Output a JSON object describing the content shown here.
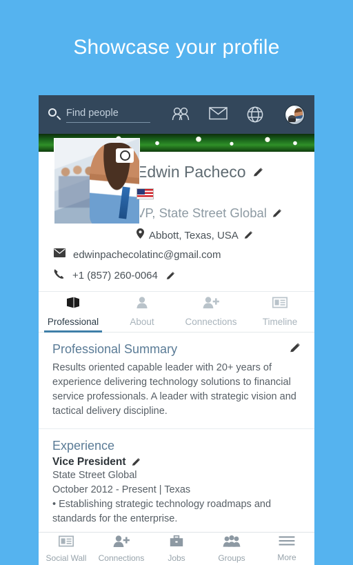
{
  "headline": "Showcase your profile",
  "theme": {
    "background": "#55b3ef",
    "appbar": "#33475b",
    "accent": "#3f7fa8",
    "section_heading": "#5a7b96",
    "muted_text": "#8d9aa3"
  },
  "appbar": {
    "search_placeholder": "Find people",
    "search_value": "",
    "icons": [
      "search-icon",
      "people-icon",
      "envelope-icon",
      "globe-icon",
      "avatar"
    ]
  },
  "profile": {
    "name": "Edwin Pacheco",
    "country_flag": "united-states-flag",
    "title": "VP, State Street Global",
    "location": "Abbott, Texas, USA",
    "email": "edwinpachecolatinc@gmail.com",
    "phone": "+1 (857) 260-0064",
    "photo_badge": "camera-icon"
  },
  "tabs": [
    {
      "label": "Professional",
      "icon": "book-icon",
      "active": true
    },
    {
      "label": "About",
      "icon": "person-icon",
      "active": false
    },
    {
      "label": "Connections",
      "icon": "person-add-icon",
      "active": false
    },
    {
      "label": "Timeline",
      "icon": "card-icon",
      "active": false
    }
  ],
  "sections": {
    "summary": {
      "title": "Professional Summary",
      "body": "Results oriented capable leader with 20+ years of experience delivering technology solutions to financial service professionals. A leader with strategic vision and tactical delivery discipline."
    },
    "experience": {
      "title": "Experience",
      "role": "Vice President",
      "company": "State Street Global",
      "period": "October 2012 - Present | Texas",
      "bullet": "• Establishing strategic technology roadmaps and standards for the enterprise."
    }
  },
  "bottom_nav": [
    {
      "label": "Social Wall",
      "icon": "card-icon"
    },
    {
      "label": "Connections",
      "icon": "person-add-icon"
    },
    {
      "label": "Jobs",
      "icon": "briefcase-icon"
    },
    {
      "label": "Groups",
      "icon": "group-icon"
    },
    {
      "label": "More",
      "icon": "hamburger-icon"
    }
  ]
}
